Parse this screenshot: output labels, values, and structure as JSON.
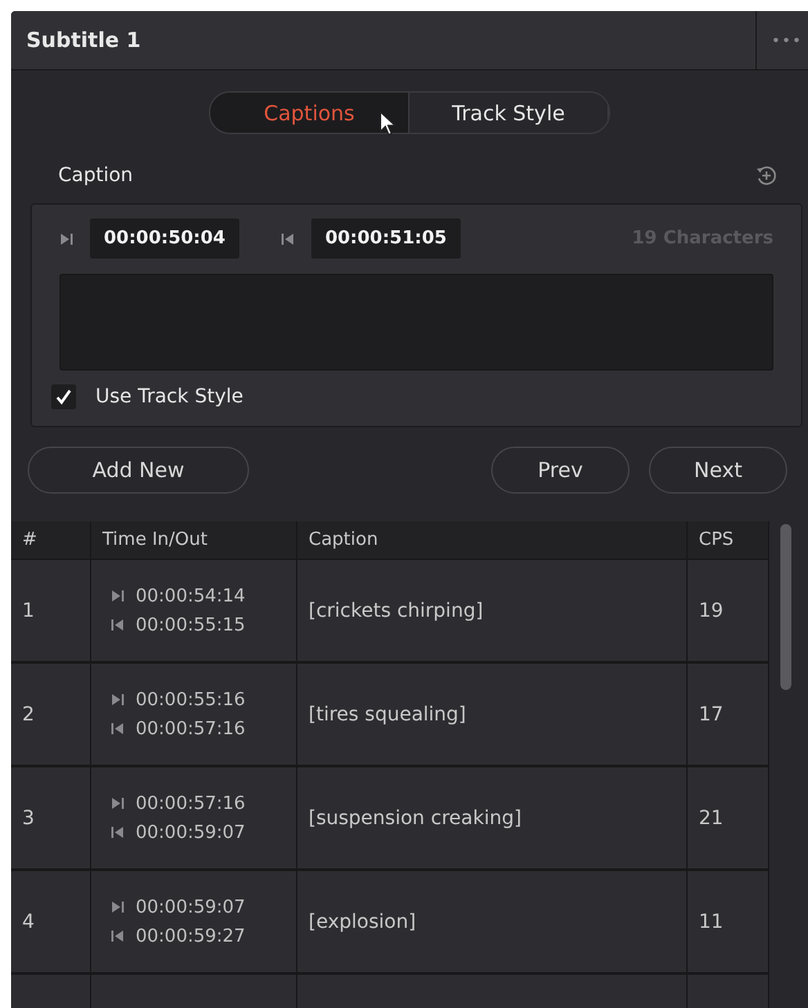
{
  "panel": {
    "title": "Subtitle 1",
    "menu": "•••"
  },
  "tabs": [
    {
      "label": "Captions",
      "selected": true
    },
    {
      "label": "Track Style",
      "selected": false
    }
  ],
  "caption": {
    "heading": "Caption",
    "time_in": "00:00:50:04",
    "time_out": "00:00:51:05",
    "char_count": "19 Characters",
    "use_track_style": {
      "label": "Use Track Style",
      "checked": true
    }
  },
  "buttons": {
    "add": "Add New",
    "prev": "Prev",
    "next": "Next"
  },
  "table": {
    "columns": [
      "#",
      "Time In/Out",
      "Caption",
      "CPS"
    ],
    "rows": [
      {
        "num": "1",
        "in": "00:00:54:14",
        "out": "00:00:55:15",
        "caption": "[crickets chirping]",
        "cps": "19"
      },
      {
        "num": "2",
        "in": "00:00:55:16",
        "out": "00:00:57:16",
        "caption": "[tires squealing]",
        "cps": "17"
      },
      {
        "num": "3",
        "in": "00:00:57:16",
        "out": "00:00:59:07",
        "caption": "[suspension creaking]",
        "cps": "21"
      },
      {
        "num": "4",
        "in": "00:00:59:07",
        "out": "00:00:59:27",
        "caption": "[explosion]",
        "cps": "11"
      }
    ]
  }
}
